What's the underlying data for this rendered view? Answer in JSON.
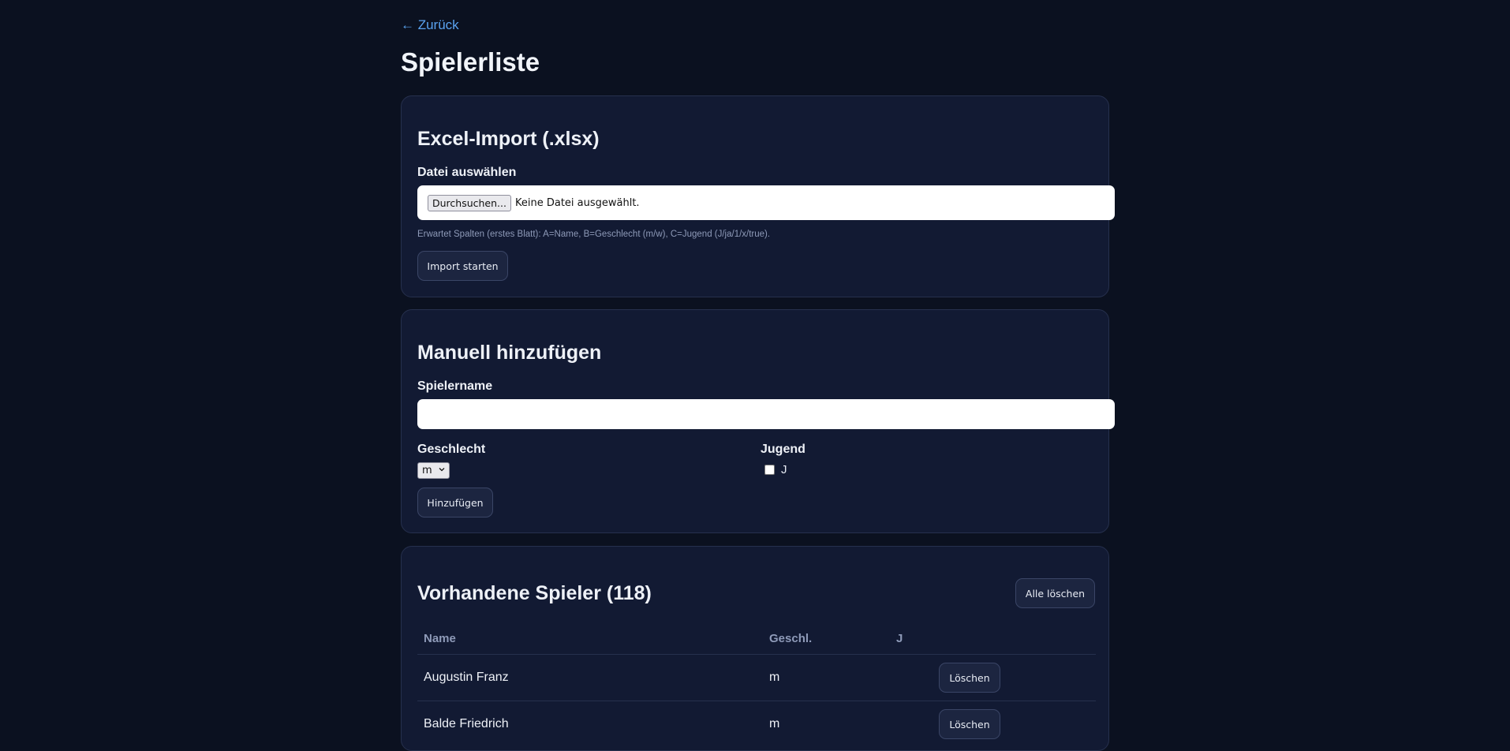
{
  "nav": {
    "back_label": "← Zurück"
  },
  "page": {
    "title": "Spielerliste"
  },
  "import_section": {
    "heading": "Excel-Import (.xlsx)",
    "file_label": "Datei auswählen",
    "browse_label": "Durchsuchen...",
    "no_file_text": "Keine Datei ausgewählt.",
    "hint": "Erwartet Spalten (erstes Blatt): A=Name, B=Geschlecht (m/w), C=Jugend (J/ja/1/x/true).",
    "submit_label": "Import starten"
  },
  "manual_section": {
    "heading": "Manuell hinzufügen",
    "name_label": "Spielername",
    "name_value": "",
    "gender_label": "Geschlecht",
    "gender_value": "m",
    "youth_label": "Jugend",
    "youth_checkbox_label": "J",
    "youth_checked": false,
    "submit_label": "Hinzufügen"
  },
  "players_section": {
    "heading": "Vorhandene Spieler (118)",
    "delete_all_label": "Alle löschen",
    "columns": [
      "Name",
      "Geschl.",
      "J",
      ""
    ],
    "rows": [
      {
        "name": "Augustin Franz",
        "gender": "m",
        "youth": "",
        "action": "Löschen"
      },
      {
        "name": "Balde Friedrich",
        "gender": "m",
        "youth": "",
        "action": "Löschen"
      }
    ]
  },
  "colors": {
    "background": "#0b1120",
    "card": "#121a33",
    "link": "#5aa3f0",
    "muted": "#8e9ab8"
  }
}
